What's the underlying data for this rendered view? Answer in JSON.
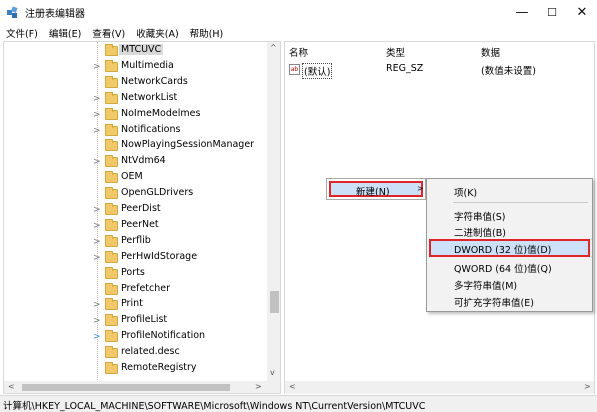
{
  "window": {
    "title": "注册表编辑器",
    "minimize": "—",
    "maximize": "☐",
    "close": "✕"
  },
  "menus": [
    "文件(F)",
    "编辑(E)",
    "查看(V)",
    "收藏夹(A)",
    "帮助(H)"
  ],
  "tree": {
    "items": [
      {
        "label": "MTCUVC",
        "expander": "",
        "selected": true
      },
      {
        "label": "Multimedia",
        "expander": ">"
      },
      {
        "label": "NetworkCards",
        "expander": ""
      },
      {
        "label": "NetworkList",
        "expander": ">"
      },
      {
        "label": "NoImeModelmes",
        "expander": ">"
      },
      {
        "label": "Notifications",
        "expander": ">"
      },
      {
        "label": "NowPlayingSessionManager",
        "expander": ""
      },
      {
        "label": "NtVdm64",
        "expander": ">"
      },
      {
        "label": "OEM",
        "expander": ""
      },
      {
        "label": "OpenGLDrivers",
        "expander": ""
      },
      {
        "label": "PeerDist",
        "expander": ">"
      },
      {
        "label": "PeerNet",
        "expander": ">"
      },
      {
        "label": "Perflib",
        "expander": ">"
      },
      {
        "label": "PerHwIdStorage",
        "expander": ">"
      },
      {
        "label": "Ports",
        "expander": ""
      },
      {
        "label": "Prefetcher",
        "expander": ""
      },
      {
        "label": "Print",
        "expander": ">"
      },
      {
        "label": "ProfileList",
        "expander": ">"
      },
      {
        "label": "ProfileNotification",
        "expander": ">",
        "blue": true
      },
      {
        "label": "related.desc",
        "expander": ""
      },
      {
        "label": "RemoteRegistry",
        "expander": ""
      }
    ]
  },
  "list": {
    "headers": {
      "name": "名称",
      "type": "类型",
      "data": "数据"
    },
    "rows": [
      {
        "icon": "ab",
        "name": "(默认)",
        "type": "REG_SZ",
        "data": "(数值未设置)"
      }
    ]
  },
  "context_menu": {
    "new_label": "新建(N)",
    "arrow": ">"
  },
  "submenu": {
    "items": [
      {
        "label": "项(K)"
      },
      {
        "label": "字符串值(S)"
      },
      {
        "label": "二进制值(B)"
      },
      {
        "label": "DWORD (32 位)值(D)",
        "highlighted": true
      },
      {
        "label": "QWORD (64 位)值(Q)"
      },
      {
        "label": "多字符串值(M)"
      },
      {
        "label": "可扩充字符串值(E)"
      }
    ]
  },
  "status_path": "计算机\\HKEY_LOCAL_MACHINE\\SOFTWARE\\Microsoft\\Windows NT\\CurrentVersion\\MTCUVC",
  "colors": {
    "highlight": "#cce0f7",
    "annotation_border": "#e0252a",
    "folder": "#f1c96b"
  }
}
